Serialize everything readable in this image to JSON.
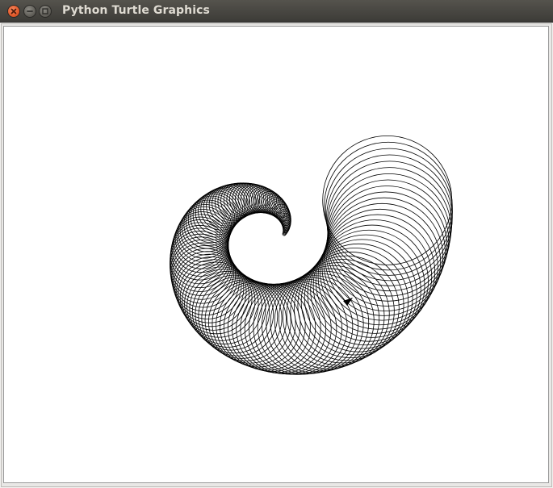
{
  "window": {
    "title": "Python Turtle Graphics",
    "controls": {
      "close_icon": "close-icon",
      "minimize_icon": "minimize-icon",
      "maximize_icon": "maximize-icon"
    }
  },
  "canvas": {
    "background": "#ffffff",
    "stroke": "#000000",
    "drawing": "turtle-spiral-of-circles"
  }
}
